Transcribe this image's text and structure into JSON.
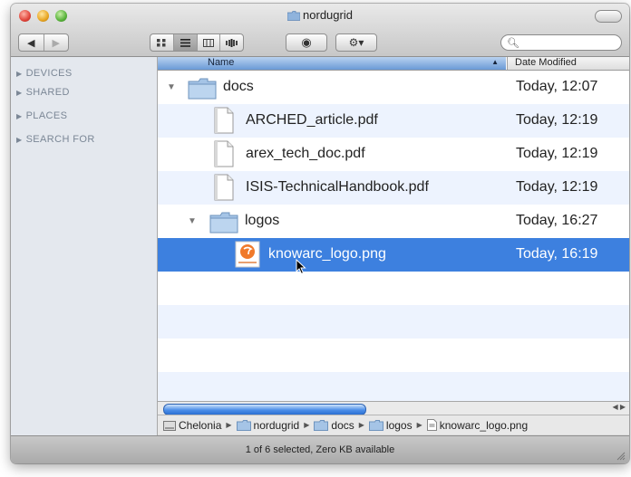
{
  "window": {
    "title": "nordugrid"
  },
  "toolbar": {
    "back_glyph": "◀",
    "forward_glyph": "▶",
    "view_icons": [
      "icon-view-icon",
      "list-view-icon",
      "column-view-icon",
      "coverflow-view-icon"
    ],
    "quicklook_glyph": "◉",
    "action_glyph": "⚙▾",
    "search_placeholder": ""
  },
  "sidebar": {
    "sections": [
      {
        "label": "DEVICES"
      },
      {
        "label": "SHARED"
      },
      {
        "label": "PLACES"
      },
      {
        "label": "SEARCH FOR"
      }
    ]
  },
  "columns": {
    "name": "Name",
    "date": "Date Modified"
  },
  "rows": [
    {
      "name": "docs",
      "date": "Today, 12:07",
      "kind": "folder",
      "level": 0,
      "expanded": true
    },
    {
      "name": "ARCHED_article.pdf",
      "date": "Today, 12:19",
      "kind": "pdf",
      "level": 1
    },
    {
      "name": "arex_tech_doc.pdf",
      "date": "Today, 12:19",
      "kind": "pdf",
      "level": 1
    },
    {
      "name": "ISIS-TechnicalHandbook.pdf",
      "date": "Today, 12:19",
      "kind": "pdf",
      "level": 1
    },
    {
      "name": "logos",
      "date": "Today, 16:27",
      "kind": "folder",
      "level": 1,
      "expanded": true
    },
    {
      "name": "knowarc_logo.png",
      "date": "Today, 16:19",
      "kind": "png",
      "level": 2,
      "selected": true
    }
  ],
  "pathbar": {
    "items": [
      {
        "label": "Chelonia"
      },
      {
        "label": "nordugrid"
      },
      {
        "label": "docs"
      },
      {
        "label": "logos"
      },
      {
        "label": "knowarc_logo.png"
      }
    ]
  },
  "status": {
    "text": "1 of 6 selected, Zero KB available"
  },
  "colors": {
    "selection": "#3d80df",
    "sidebar_bg": "#e4e8ee",
    "alt_row": "#edf3fe"
  }
}
